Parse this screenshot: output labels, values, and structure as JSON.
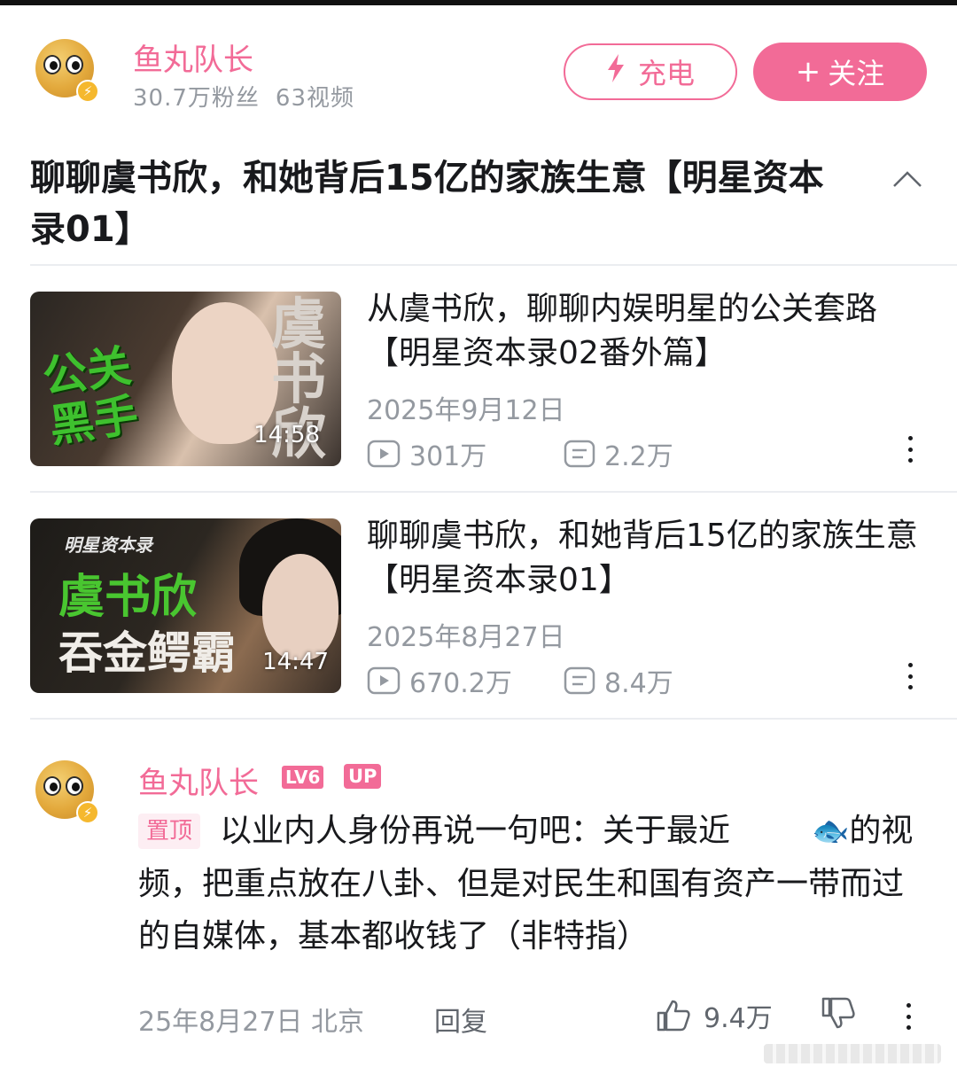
{
  "uploader": {
    "name": "鱼丸队长",
    "followers": "30.7万粉丝",
    "video_count": "63视频"
  },
  "actions": {
    "charge_label": "充电",
    "follow_label": "关注"
  },
  "collection": {
    "title": "聊聊虞书欣，和她背后15亿的家族生意【明星资本录01】"
  },
  "videos": [
    {
      "title": "从虞书欣，聊聊内娱明星的公关套路【明星资本录02番外篇】",
      "date": "2025年9月12日",
      "views": "301万",
      "danmaku": "2.2万",
      "duration": "14:58",
      "thumb_text_a": "公关",
      "thumb_text_b": "黑手",
      "thumb_side_text": "虞书欣"
    },
    {
      "title": "聊聊虞书欣，和她背后15亿的家族生意【明星资本录01】",
      "date": "2025年8月27日",
      "views": "670.2万",
      "danmaku": "8.4万",
      "duration": "14:47",
      "thumb_caption": "明星资本录",
      "thumb_text_a": "虞书欣",
      "thumb_text_b": "吞金鳄霸"
    }
  ],
  "comment": {
    "author": "鱼丸队长",
    "level": "LV6",
    "up_badge": "UP",
    "pinned_label": "置顶",
    "text_before_emoji": "以业内人身份再说一句吧：关于最近",
    "emoji": "🐟",
    "text_after_emoji": "的视频，把重点放在八卦、但是对民生和国有资产一带而过的自媒体，基本都收钱了（非特指）",
    "time_location": "25年8月27日 北京",
    "reply_label": "回复",
    "likes": "9.4万"
  }
}
